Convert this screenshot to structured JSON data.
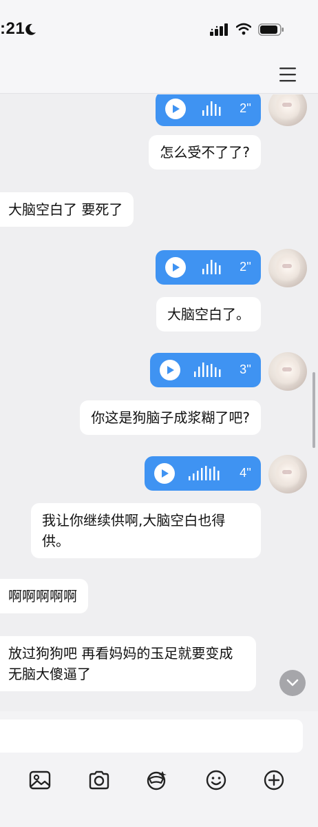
{
  "status_bar": {
    "time": ":21",
    "icons": [
      "moon-icon",
      "signal-icon",
      "wifi-icon",
      "battery-icon"
    ]
  },
  "nav": {
    "menu_icon": "hamburger-menu-icon"
  },
  "messages": [
    {
      "type": "voice",
      "side": "right",
      "duration": "2''"
    },
    {
      "type": "text",
      "side": "right",
      "text": "怎么受不了了?"
    },
    {
      "type": "text",
      "side": "left",
      "text": "大脑空白了 要死了"
    },
    {
      "type": "voice",
      "side": "right",
      "duration": "2''"
    },
    {
      "type": "text",
      "side": "right",
      "text": "大脑空白了。"
    },
    {
      "type": "voice",
      "side": "right",
      "duration": "3''"
    },
    {
      "type": "text",
      "side": "right",
      "text": "你这是狗脑子成浆糊了吧?"
    },
    {
      "type": "voice",
      "side": "right",
      "duration": "4''"
    },
    {
      "type": "text",
      "side": "right",
      "text": "我让你继续供啊,大脑空白也得供。"
    },
    {
      "type": "text",
      "side": "left",
      "text": "啊啊啊啊啊"
    },
    {
      "type": "text",
      "side": "left",
      "text": "放过狗狗吧 再看妈妈的玉足就要变成无脑大傻逼了"
    }
  ],
  "input": {
    "value": "",
    "placeholder": ""
  },
  "toolbar": {
    "items": [
      "image-icon",
      "camera-icon",
      "sticker-icon",
      "emoji-icon",
      "plus-icon"
    ]
  },
  "colors": {
    "voice_bubble": "#3f93f2",
    "background": "#efeff1",
    "bubble": "#ffffff"
  }
}
